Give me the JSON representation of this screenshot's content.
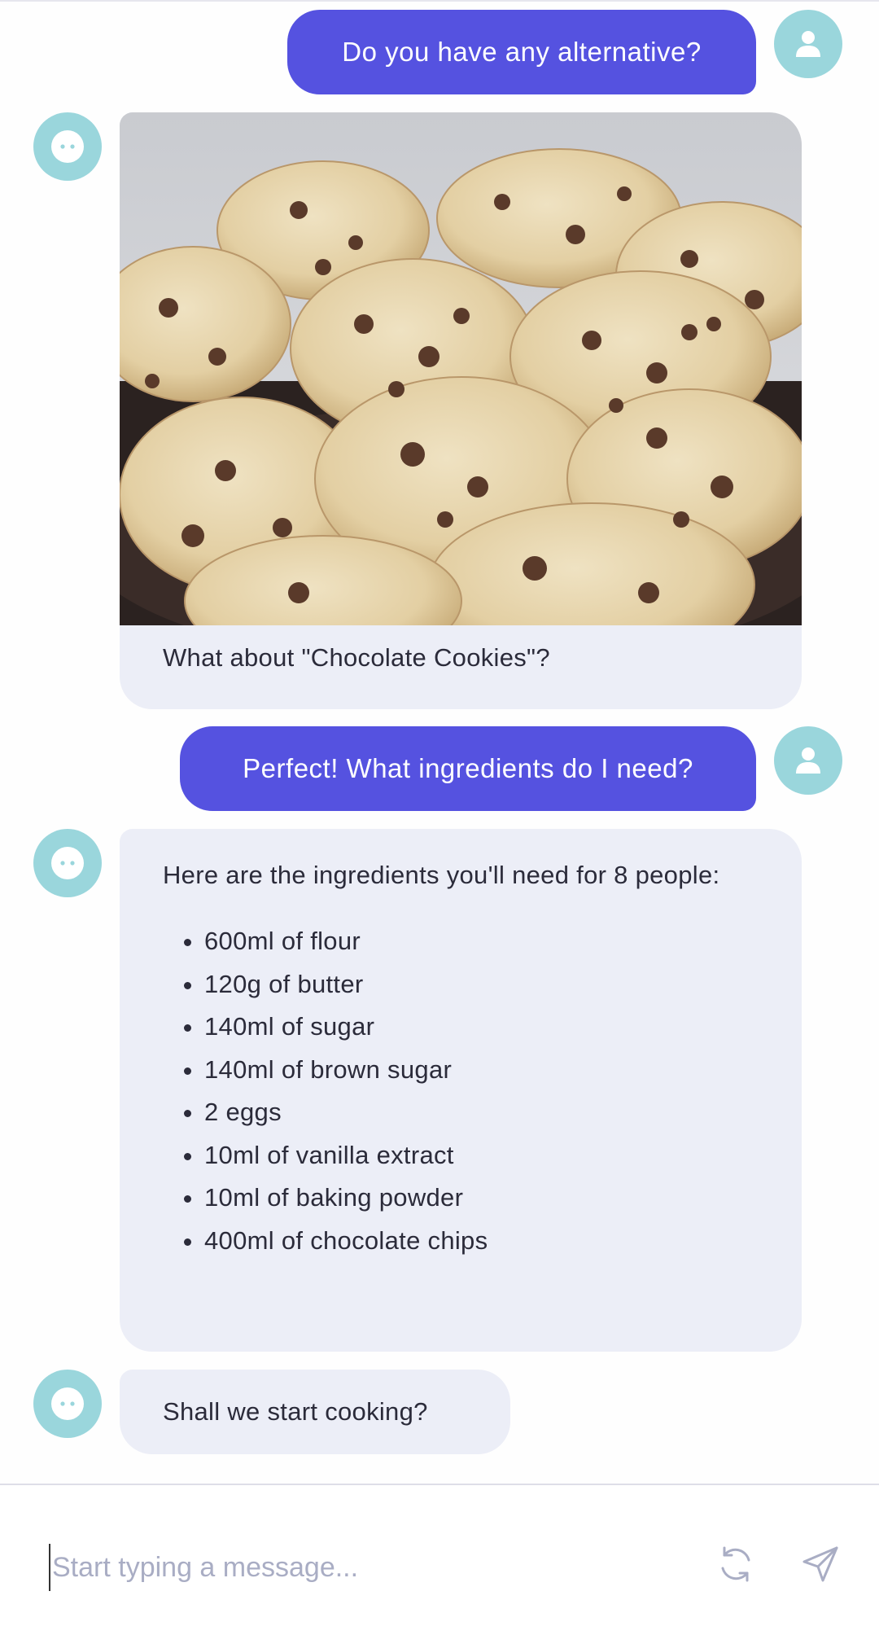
{
  "messages": {
    "user_1": "Do you have any alternative?",
    "bot_image_caption": "What about \"Chocolate Cookies\"?",
    "user_2": "Perfect! What ingredients do I need?",
    "bot_ingredients_intro": "Here are the ingredients you'll need for 8 people:",
    "ingredients": [
      "600ml of flour",
      "120g of butter",
      "140ml of sugar",
      "140ml of brown sugar",
      "2 eggs",
      "10ml of vanilla extract",
      "10ml of baking powder",
      "400ml of chocolate chips"
    ],
    "bot_question": "Shall we start cooking?"
  },
  "composer": {
    "placeholder": "Start typing a message...",
    "refresh_icon": "refresh-icon",
    "send_icon": "send-icon"
  },
  "icons": {
    "user_avatar": "user-avatar-icon",
    "bot_avatar": "bot-avatar-icon"
  },
  "colors": {
    "user_bubble": "#5552e0",
    "bot_bubble": "#eceef7",
    "avatar": "#9ad6dc"
  }
}
